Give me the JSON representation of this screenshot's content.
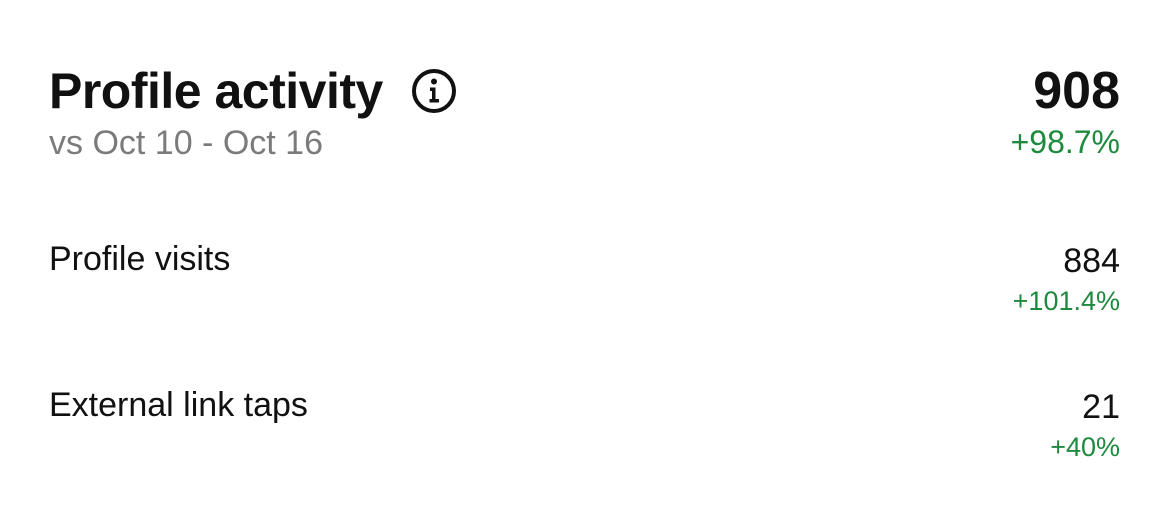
{
  "header": {
    "title": "Profile activity",
    "info_icon": "info-circle-icon",
    "subtitle": "vs Oct 10 - Oct 16",
    "total_value": "908",
    "total_change": "+98.7%"
  },
  "metrics": [
    {
      "label": "Profile visits",
      "value": "884",
      "change": "+101.4%"
    },
    {
      "label": "External link taps",
      "value": "21",
      "change": "+40%"
    }
  ],
  "colors": {
    "positive_change": "#1e8a3e",
    "secondary_text": "#7b7b7b",
    "primary_text": "#111111"
  }
}
